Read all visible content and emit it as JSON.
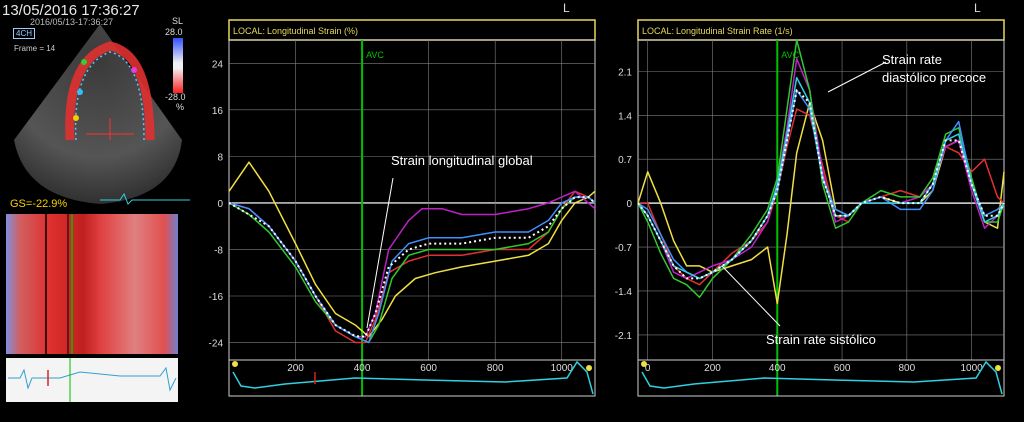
{
  "header": {
    "datetime": "13/05/2016 17:36:27",
    "sub_datetime": "2016/05/13-17:36:27",
    "view": "4CH",
    "frame": "Frame = 14"
  },
  "scale": {
    "label": "SL",
    "max": "28.0",
    "min": "-28.0",
    "unit": "%"
  },
  "gs_value": "GS=-22.9%",
  "corner_marker": "L",
  "colors": {
    "red": "#e23030",
    "magenta": "#c020c8",
    "green": "#30c830",
    "blue": "#4090ff",
    "cyan": "#30d0e0",
    "yellow": "#f0e040",
    "avg": "#ffffff",
    "avc": "#00c000",
    "frame": "#e8d85a",
    "grid": "#808080"
  },
  "chart_data": [
    {
      "type": "line",
      "panel_title": "LOCAL:",
      "title": "Longitudinal Strain (%)",
      "marker": {
        "label": "AVC",
        "x": 400
      },
      "xlim": [
        0,
        1100
      ],
      "ylim": [
        -27,
        28
      ],
      "xticks": [
        "200",
        "400",
        "600",
        "800",
        "1000"
      ],
      "yticks": [
        "24",
        "16",
        "8",
        "0",
        "-8",
        "-16",
        "-24"
      ],
      "annotation": "Strain longitudinal global",
      "series": [
        {
          "color": "yellow",
          "x": [
            0,
            60,
            120,
            200,
            260,
            320,
            380,
            420,
            460,
            500,
            560,
            620,
            700,
            800,
            900,
            960,
            1000,
            1040,
            1080,
            1100
          ],
          "y": [
            2,
            7,
            2,
            -7,
            -14,
            -19,
            -21,
            -23,
            -20,
            -16,
            -13,
            -12,
            -11,
            -10,
            -9,
            -7,
            -3,
            0,
            1,
            2
          ]
        },
        {
          "color": "red",
          "x": [
            0,
            60,
            120,
            200,
            260,
            320,
            380,
            410,
            440,
            480,
            540,
            600,
            700,
            800,
            900,
            960,
            1000,
            1040,
            1080,
            1100
          ],
          "y": [
            0,
            -1,
            -4,
            -10,
            -16,
            -22,
            -24,
            -24,
            -20,
            -12,
            -10,
            -9,
            -9,
            -8,
            -8,
            -5,
            -1,
            2,
            1,
            0
          ]
        },
        {
          "color": "magenta",
          "x": [
            0,
            60,
            120,
            200,
            260,
            320,
            380,
            410,
            440,
            480,
            540,
            580,
            640,
            700,
            800,
            900,
            960,
            1000,
            1040,
            1080,
            1100
          ],
          "y": [
            0,
            -1,
            -4,
            -10,
            -16,
            -21,
            -23,
            -23,
            -19,
            -8,
            -3,
            -1,
            -1,
            -2,
            -2,
            -1,
            0,
            1,
            2,
            0,
            -1
          ]
        },
        {
          "color": "green",
          "x": [
            0,
            60,
            120,
            200,
            260,
            320,
            380,
            420,
            450,
            490,
            540,
            600,
            700,
            800,
            900,
            960,
            1000,
            1040,
            1080,
            1100
          ],
          "y": [
            0,
            -2,
            -5,
            -11,
            -17,
            -21,
            -23,
            -24,
            -21,
            -13,
            -9,
            -8,
            -8,
            -8,
            -7,
            -5,
            -1,
            1,
            1,
            0
          ]
        },
        {
          "color": "blue",
          "x": [
            0,
            60,
            120,
            200,
            260,
            320,
            380,
            420,
            450,
            490,
            540,
            600,
            700,
            800,
            900,
            960,
            1000,
            1040,
            1080,
            1100
          ],
          "y": [
            0,
            -1,
            -4,
            -10,
            -16,
            -21,
            -23,
            -24,
            -19,
            -10,
            -7,
            -6,
            -6,
            -5,
            -5,
            -3,
            0,
            1,
            1,
            0
          ]
        },
        {
          "color": "avg",
          "x": [
            0,
            60,
            120,
            200,
            260,
            320,
            380,
            410,
            440,
            480,
            540,
            600,
            700,
            800,
            900,
            960,
            1000,
            1040,
            1080,
            1100
          ],
          "y": [
            0,
            -2,
            -4,
            -10,
            -16,
            -21,
            -22.9,
            -23,
            -19,
            -11,
            -8,
            -7,
            -7,
            -6,
            -6,
            -4,
            -1,
            1,
            1,
            0
          ]
        }
      ]
    },
    {
      "type": "line",
      "panel_title": "LOCAL:",
      "title": "Longitudinal Strain Rate (1/s)",
      "marker": {
        "label": "AVC",
        "x": 400
      },
      "xlim": [
        -30,
        1100
      ],
      "ylim": [
        -2.5,
        2.6
      ],
      "xticks": [
        "0",
        "200",
        "400",
        "600",
        "800",
        "1000"
      ],
      "yticks": [
        "2.1",
        "1.4",
        "0.7",
        "0",
        "-0.7",
        "-1.4",
        "-2.1"
      ],
      "annotations": [
        "Strain rate",
        "diastólico precoce",
        "Strain rate sistólico"
      ],
      "series": [
        {
          "color": "yellow",
          "x": [
            -30,
            0,
            40,
            80,
            120,
            160,
            200,
            260,
            320,
            370,
            400,
            430,
            460,
            500,
            540,
            580,
            620,
            660,
            720,
            780,
            840,
            880,
            920,
            960,
            1000,
            1040,
            1080,
            1100
          ],
          "y": [
            0,
            0.5,
            0,
            -0.6,
            -1.0,
            -1.0,
            -1.1,
            -1.0,
            -0.9,
            -0.7,
            -1.6,
            -0.5,
            0.8,
            1.6,
            1.0,
            -0.1,
            -0.2,
            0.0,
            0.1,
            0.0,
            0.0,
            0.2,
            0.9,
            1.0,
            0.3,
            -0.3,
            -0.4,
            0.5
          ]
        },
        {
          "color": "red",
          "x": [
            -30,
            0,
            40,
            80,
            120,
            160,
            200,
            260,
            320,
            370,
            400,
            430,
            460,
            500,
            540,
            580,
            620,
            660,
            720,
            780,
            840,
            880,
            920,
            960,
            1000,
            1040,
            1080,
            1100
          ],
          "y": [
            0,
            0,
            -0.5,
            -1.0,
            -1.2,
            -1.3,
            -1.1,
            -0.8,
            -0.6,
            -0.3,
            0.2,
            0.9,
            1.5,
            1.4,
            0.6,
            -0.2,
            -0.3,
            0.0,
            0.1,
            0.2,
            0.1,
            0.4,
            0.9,
            0.8,
            0.5,
            0.7,
            0.1,
            0
          ]
        },
        {
          "color": "magenta",
          "x": [
            -30,
            0,
            40,
            80,
            120,
            160,
            200,
            260,
            320,
            370,
            400,
            430,
            460,
            500,
            540,
            580,
            620,
            660,
            720,
            780,
            840,
            880,
            920,
            960,
            1000,
            1040,
            1080,
            1100
          ],
          "y": [
            0,
            -0.2,
            -0.6,
            -1.1,
            -1.2,
            -1.1,
            -1.0,
            -0.9,
            -0.7,
            -0.3,
            0.3,
            1.2,
            2.3,
            1.8,
            0.5,
            -0.3,
            -0.2,
            0.0,
            0.0,
            0.0,
            0.1,
            0.3,
            0.9,
            1.0,
            0.2,
            -0.4,
            -0.2,
            0
          ]
        },
        {
          "color": "green",
          "x": [
            -30,
            0,
            40,
            80,
            120,
            160,
            200,
            260,
            320,
            370,
            400,
            430,
            460,
            500,
            540,
            580,
            620,
            660,
            720,
            780,
            840,
            880,
            920,
            960,
            1000,
            1040,
            1080,
            1100
          ],
          "y": [
            0,
            -0.3,
            -0.8,
            -1.2,
            -1.3,
            -1.5,
            -1.2,
            -0.9,
            -0.5,
            -0.1,
            0.4,
            1.5,
            2.6,
            1.8,
            0.3,
            -0.4,
            -0.3,
            0.0,
            0.2,
            0.1,
            0.1,
            0.4,
            1.1,
            1.2,
            0.4,
            -0.3,
            -0.3,
            0
          ]
        },
        {
          "color": "blue",
          "x": [
            -30,
            0,
            40,
            80,
            120,
            160,
            200,
            260,
            320,
            370,
            400,
            430,
            460,
            500,
            540,
            580,
            620,
            660,
            720,
            780,
            840,
            880,
            920,
            960,
            1000,
            1040,
            1080,
            1100
          ],
          "y": [
            0,
            -0.1,
            -0.5,
            -0.9,
            -1.1,
            -1.2,
            -1.1,
            -0.9,
            -0.6,
            -0.2,
            0.2,
            1.0,
            1.8,
            1.5,
            0.4,
            -0.1,
            -0.2,
            0.0,
            0.1,
            -0.1,
            -0.1,
            0.2,
            1.0,
            1.3,
            0.3,
            -0.2,
            -0.1,
            0
          ]
        },
        {
          "color": "cyan",
          "x": [
            -30,
            0,
            40,
            80,
            120,
            160,
            200,
            260,
            320,
            370,
            400,
            430,
            460,
            500,
            540,
            580,
            620,
            660,
            720,
            780,
            840,
            880,
            920,
            960,
            1000,
            1040,
            1080,
            1100
          ],
          "y": [
            0,
            -0.2,
            -0.6,
            -1.0,
            -1.1,
            -1.2,
            -1.1,
            -0.9,
            -0.6,
            -0.2,
            0.3,
            1.1,
            2.0,
            1.6,
            0.4,
            -0.2,
            -0.2,
            0.0,
            0.0,
            0.0,
            0.0,
            0.3,
            1.0,
            1.1,
            0.3,
            -0.3,
            -0.2,
            0
          ]
        },
        {
          "color": "avg",
          "x": [
            -30,
            0,
            40,
            80,
            120,
            160,
            200,
            260,
            320,
            370,
            400,
            430,
            460,
            500,
            540,
            580,
            620,
            660,
            720,
            780,
            840,
            880,
            920,
            960,
            1000,
            1040,
            1080,
            1100
          ],
          "y": [
            0,
            -0.2,
            -0.6,
            -1.0,
            -1.2,
            -1.2,
            -1.1,
            -0.9,
            -0.6,
            -0.2,
            0.2,
            1.0,
            1.8,
            1.6,
            0.4,
            -0.2,
            -0.2,
            0.0,
            0.1,
            0.0,
            0.0,
            0.3,
            1.0,
            1.0,
            0.3,
            -0.2,
            -0.2,
            0
          ]
        }
      ]
    }
  ]
}
